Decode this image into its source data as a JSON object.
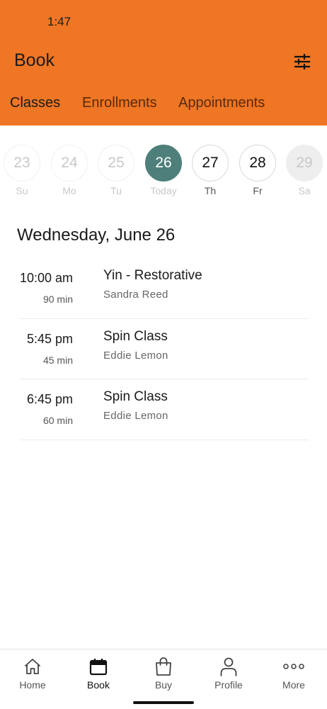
{
  "status_bar": {
    "time": "1:47"
  },
  "header": {
    "title": "Book",
    "filter_icon": "sliders-icon"
  },
  "tabs": [
    {
      "label": "Classes",
      "active": true
    },
    {
      "label": "Enrollments",
      "active": false
    },
    {
      "label": "Appointments",
      "active": false
    }
  ],
  "week": [
    {
      "number": "23",
      "label": "Su",
      "state": "past"
    },
    {
      "number": "24",
      "label": "Mo",
      "state": "past"
    },
    {
      "number": "25",
      "label": "Tu",
      "state": "past"
    },
    {
      "number": "26",
      "label": "Today",
      "state": "today"
    },
    {
      "number": "27",
      "label": "Th",
      "state": "future"
    },
    {
      "number": "28",
      "label": "Fr",
      "state": "future"
    },
    {
      "number": "29",
      "label": "Sa",
      "state": "disabled"
    }
  ],
  "schedule": {
    "date_heading": "Wednesday, June 26",
    "classes": [
      {
        "time": "10:00 am",
        "duration": "90 min",
        "name": "Yin - Restorative",
        "instructor": "Sandra Reed"
      },
      {
        "time": "5:45 pm",
        "duration": "45 min",
        "name": "Spin Class",
        "instructor": "Eddie Lemon"
      },
      {
        "time": "6:45 pm",
        "duration": "60 min",
        "name": "Spin Class",
        "instructor": "Eddie Lemon"
      }
    ]
  },
  "bottom_nav": [
    {
      "label": "Home",
      "icon": "home-icon",
      "active": false
    },
    {
      "label": "Book",
      "icon": "calendar-icon",
      "active": true
    },
    {
      "label": "Buy",
      "icon": "shopping-bag-icon",
      "active": false
    },
    {
      "label": "Profile",
      "icon": "person-icon",
      "active": false
    },
    {
      "label": "More",
      "icon": "more-dots-icon",
      "active": false
    }
  ],
  "colors": {
    "header": "#EE7624",
    "today_circle": "#4E7F7A",
    "tab_inactive": "#5a2a0c"
  }
}
